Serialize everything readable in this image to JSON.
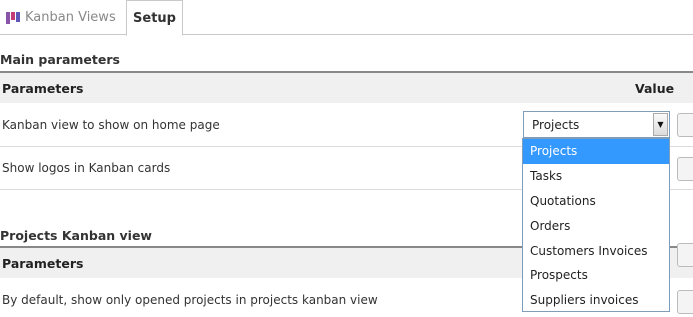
{
  "tabs": {
    "kanban_views": "Kanban Views",
    "setup": "Setup"
  },
  "main_parameters": {
    "title": "Main parameters",
    "header": {
      "parameters": "Parameters",
      "value": "Value"
    },
    "rows": [
      {
        "label": "Kanban view to show on home page",
        "value": "Projects"
      },
      {
        "label": "Show logos in Kanban cards"
      }
    ]
  },
  "projects_kanban": {
    "title": "Projects Kanban view",
    "header": {
      "parameters": "Parameters"
    },
    "rows": [
      {
        "label": "By default, show only opened projects in projects kanban view"
      }
    ]
  },
  "dropdown": {
    "selected": "Projects",
    "options": [
      "Projects",
      "Tasks",
      "Quotations",
      "Orders",
      "Customers Invoices",
      "Prospects",
      "Suppliers invoices"
    ]
  },
  "icons": {
    "tab_icon": "kanban-board-icon",
    "select_arrow": "chevron-down-icon"
  },
  "colors": {
    "selection": "#3399ff",
    "header_bg": "#f0f0f0",
    "header_border": "#888888"
  }
}
